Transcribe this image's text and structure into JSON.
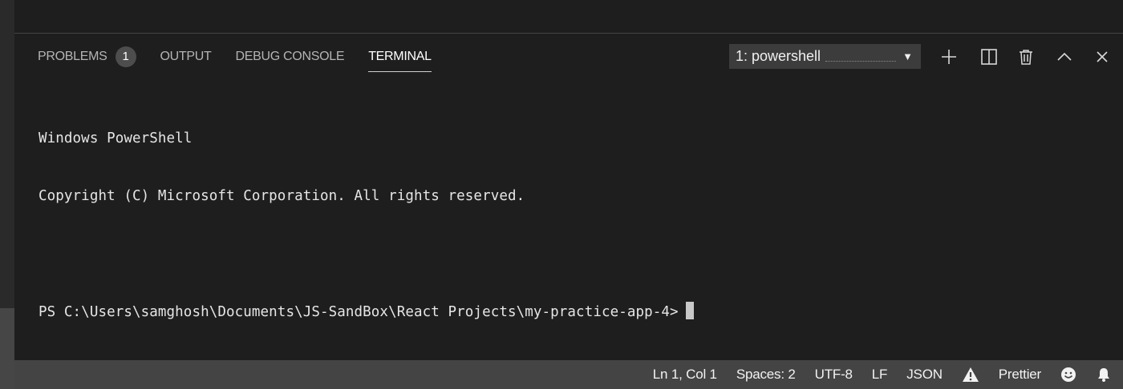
{
  "panel": {
    "tabs": [
      {
        "label": "PROBLEMS",
        "badge": "1"
      },
      {
        "label": "OUTPUT"
      },
      {
        "label": "DEBUG CONSOLE"
      },
      {
        "label": "TERMINAL",
        "active": true
      }
    ],
    "terminal_select": {
      "value": "1: powershell"
    },
    "actions": [
      "plus-icon",
      "split-icon",
      "trash-icon",
      "chevron-up-icon",
      "close-icon"
    ]
  },
  "terminal": {
    "lines": [
      "Windows PowerShell",
      "Copyright (C) Microsoft Corporation. All rights reserved.",
      "",
      "PS C:\\Users\\samghosh\\Documents\\JS-SandBox\\React Projects\\my-practice-app-4>"
    ]
  },
  "statusbar": {
    "position": "Ln 1, Col 1",
    "spaces": "Spaces: 2",
    "encoding": "UTF-8",
    "eol": "LF",
    "language": "JSON",
    "formatter": "Prettier",
    "icons": [
      "warning-icon",
      "smiley-icon",
      "bell-icon"
    ]
  },
  "colors": {
    "background": "#1e1e1e",
    "statusbar": "#444444",
    "select": "#3c3c3c",
    "badge": "#4d4d4d"
  }
}
